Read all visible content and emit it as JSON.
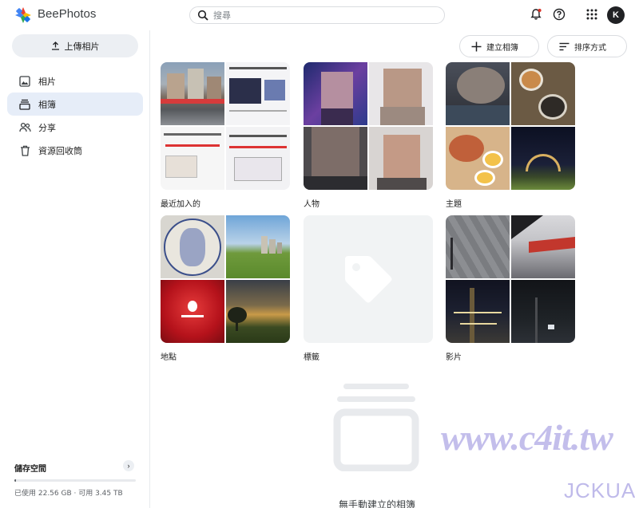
{
  "app": {
    "brand": "BeePhotos"
  },
  "header": {
    "search_placeholder": "搜尋",
    "avatar_letter": "K"
  },
  "sidebar": {
    "upload_label": "上傳相片",
    "items": [
      {
        "label": "相片",
        "icon": "photo-icon",
        "active": false
      },
      {
        "label": "相簿",
        "icon": "album-icon",
        "active": true
      },
      {
        "label": "分享",
        "icon": "people-icon",
        "active": false
      },
      {
        "label": "資源回收筒",
        "icon": "trash-icon",
        "active": false
      }
    ],
    "storage": {
      "title": "儲存空間",
      "text": "已使用 22.56 GB · 可用 3.45 TB",
      "used_fraction": 0.0064
    }
  },
  "toolbar": {
    "create_label": "建立相簿",
    "sort_label": "排序方式"
  },
  "albums": [
    {
      "label": "最近加入的"
    },
    {
      "label": "人物"
    },
    {
      "label": "主題"
    },
    {
      "label": "地點"
    },
    {
      "label": "標籤"
    },
    {
      "label": "影片"
    }
  ],
  "empty_state": {
    "text": "無手動建立的相簿"
  },
  "watermark": {
    "main": "www.c4it.tw",
    "sub": "JCKUAN"
  },
  "colors": {
    "accent": "#1a73e8",
    "active_nav": "#e6edf8",
    "avatar": "#202124",
    "notification_dot": "#d93025"
  }
}
